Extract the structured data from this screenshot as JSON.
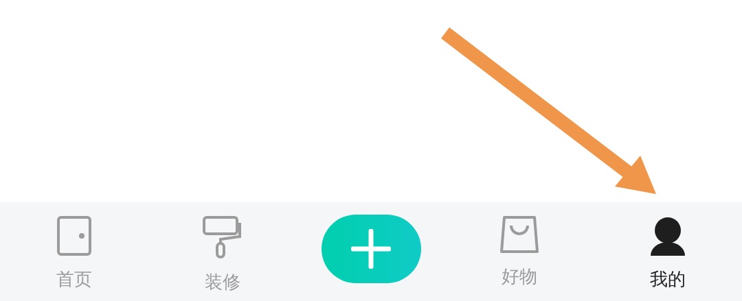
{
  "tab_bar": {
    "tabs": [
      {
        "kind": "home",
        "label": "首页",
        "selected": false
      },
      {
        "kind": "decor",
        "label": "装修",
        "selected": false
      },
      {
        "kind": "add",
        "selected": false
      },
      {
        "kind": "shop",
        "label": "好物",
        "selected": false
      },
      {
        "kind": "profile",
        "label": "我的",
        "selected": true
      }
    ]
  }
}
